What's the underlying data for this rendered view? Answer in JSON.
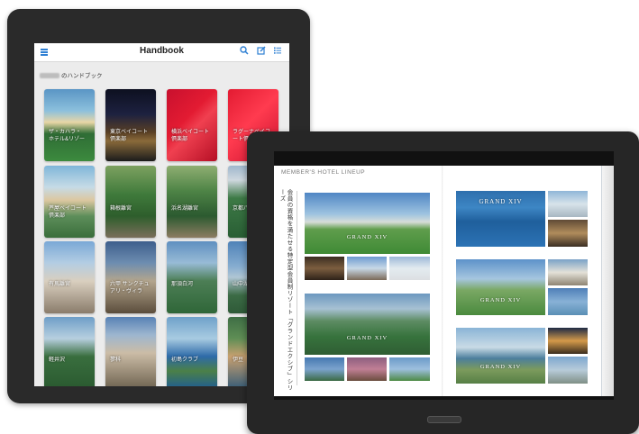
{
  "handbook_app": {
    "title": "Handbook",
    "owner_name_suffix": "のハンドブック",
    "icons": [
      "menu-icon",
      "search-icon",
      "edit-icon",
      "list-icon"
    ],
    "books": [
      {
        "label": "ザ・カハラ・\nホテル&リゾー"
      },
      {
        "label": "東京ベイコート\n倶楽部"
      },
      {
        "label": "横浜ベイコート\n倶楽部"
      },
      {
        "label": "ラグーナベイコ\nート倶楽"
      },
      {
        "label": "芦屋ベイコート\n倶楽部"
      },
      {
        "label": "箱根離宮"
      },
      {
        "label": "浜名湖離宮"
      },
      {
        "label": "京都八瀬"
      },
      {
        "label": "有馬離宮"
      },
      {
        "label": "六甲 サンクチュ\nアリ・ヴィラ"
      },
      {
        "label": "那須白河"
      },
      {
        "label": "山中湖"
      },
      {
        "label": "軽井沢"
      },
      {
        "label": "蓼科"
      },
      {
        "label": "初島クラブ"
      },
      {
        "label": "伊豆"
      }
    ]
  },
  "catalog": {
    "heading": "MEMBER'S HOTEL LINEUP",
    "vertical_text": "会員の資格を満たせる特定型会員制リゾート「グランドエクシブ」シリーズ",
    "logos": [
      "GRAND XIV",
      "GRAND XIV",
      "GRAND XIV",
      "GRAND XIV",
      "GRAND XIV",
      "GRAND XIV"
    ]
  }
}
